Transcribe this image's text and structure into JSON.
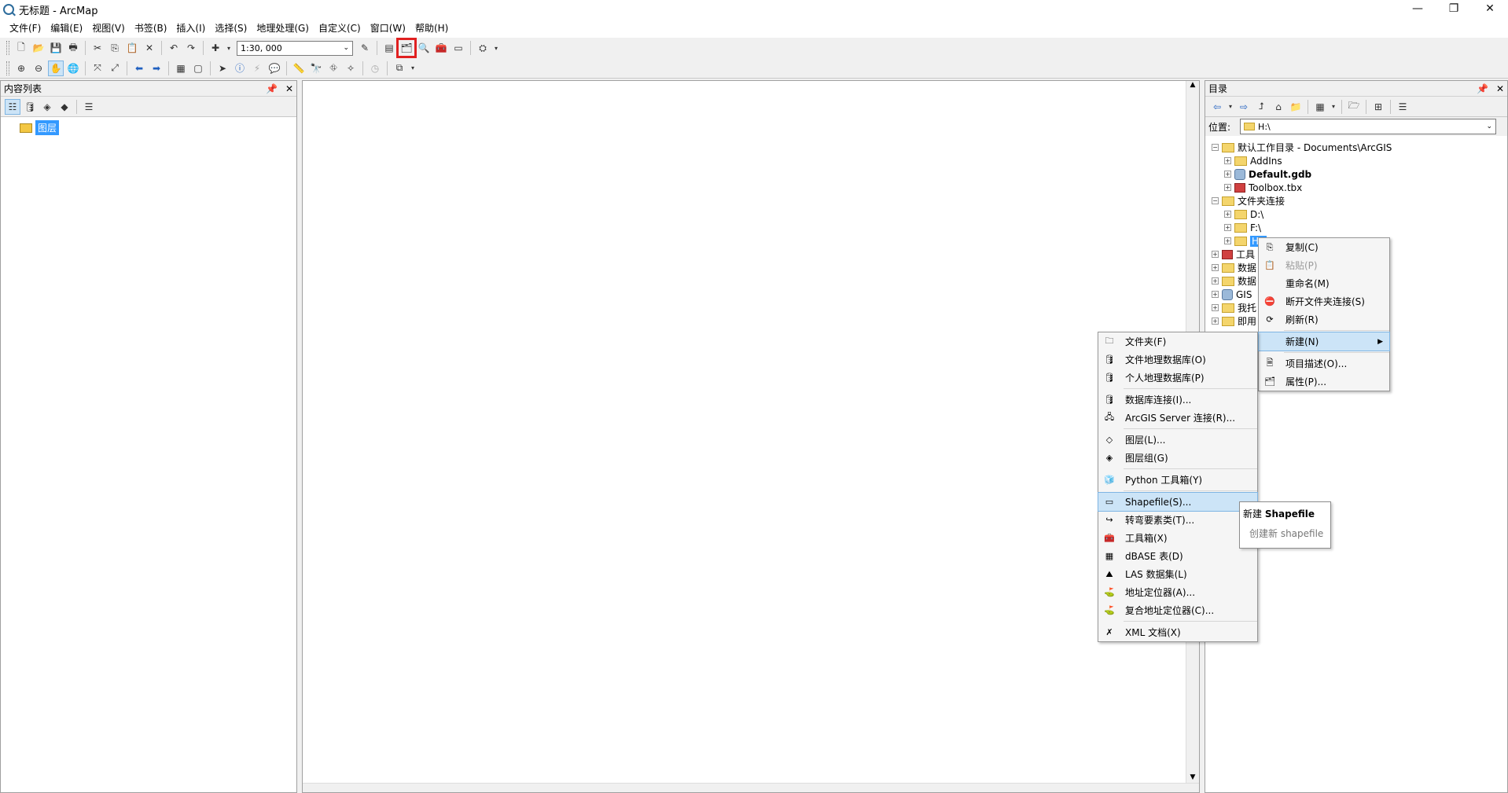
{
  "window": {
    "title": "无标题 - ArcMap"
  },
  "menubar": [
    "文件(F)",
    "编辑(E)",
    "视图(V)",
    "书签(B)",
    "插入(I)",
    "选择(S)",
    "地理处理(G)",
    "自定义(C)",
    "窗口(W)",
    "帮助(H)"
  ],
  "toolbar": {
    "scale_value": "1:30, 000"
  },
  "toc": {
    "title": "内容列表",
    "layer_label": "图层"
  },
  "catalog": {
    "title": "目录",
    "location_label": "位置:",
    "location_value": "H:\\",
    "tree": [
      {
        "label": "默认工作目录 - Documents\\ArcGIS",
        "level": 0,
        "icon": "folder-home-icon",
        "exp": "−"
      },
      {
        "label": "AddIns",
        "level": 1,
        "icon": "folder-icon",
        "exp": "+"
      },
      {
        "label": "Default.gdb",
        "level": 1,
        "icon": "geodatabase-icon",
        "exp": "+",
        "bold": true
      },
      {
        "label": "Toolbox.tbx",
        "level": 1,
        "icon": "toolbox-icon",
        "exp": "+"
      },
      {
        "label": "文件夹连接",
        "level": 0,
        "icon": "folder-icon",
        "exp": "−"
      },
      {
        "label": "D:\\",
        "level": 1,
        "icon": "folder-icon",
        "exp": "+"
      },
      {
        "label": "F:\\",
        "level": 1,
        "icon": "folder-icon",
        "exp": "+"
      },
      {
        "label": "H:\\",
        "level": 1,
        "icon": "folder-icon",
        "exp": "+",
        "selected": true
      },
      {
        "label": "工具",
        "level": 0,
        "icon": "toolbox-icon",
        "exp": "+"
      },
      {
        "label": "数据",
        "level": 0,
        "icon": "folder-icon",
        "exp": "+"
      },
      {
        "label": "数据",
        "level": 0,
        "icon": "folder-icon",
        "exp": "+"
      },
      {
        "label": "GIS",
        "level": 0,
        "icon": "gis-server-icon",
        "exp": "+"
      },
      {
        "label": "我托",
        "level": 0,
        "icon": "folder-icon",
        "exp": "+"
      },
      {
        "label": "即用",
        "level": 0,
        "icon": "folder-icon",
        "exp": "+"
      }
    ]
  },
  "context_menu": [
    {
      "label": "复制(C)",
      "icon": "copy-icon"
    },
    {
      "label": "粘贴(P)",
      "icon": "paste-icon",
      "disabled": true
    },
    {
      "label": "重命名(M)",
      "icon": ""
    },
    {
      "label": "断开文件夹连接(S)",
      "icon": "disconnect-icon"
    },
    {
      "label": "刷新(R)",
      "icon": "refresh-icon",
      "sep_after": true
    },
    {
      "label": "新建(N)",
      "icon": "",
      "active": true,
      "submenu": true,
      "sep_after": true
    },
    {
      "label": "项目描述(O)...",
      "icon": "description-icon"
    },
    {
      "label": "属性(P)...",
      "icon": "properties-icon"
    }
  ],
  "new_menu": [
    {
      "label": "文件夹(F)",
      "icon": "folder-icon"
    },
    {
      "label": "文件地理数据库(O)",
      "icon": "file-gdb-icon"
    },
    {
      "label": "个人地理数据库(P)",
      "icon": "personal-gdb-icon",
      "sep_after": true
    },
    {
      "label": "数据库连接(I)...",
      "icon": "db-connection-icon"
    },
    {
      "label": "ArcGIS Server 连接(R)...",
      "icon": "server-connection-icon",
      "sep_after": true
    },
    {
      "label": "图层(L)...",
      "icon": "layer-icon"
    },
    {
      "label": "图层组(G)",
      "icon": "group-layer-icon",
      "sep_after": true
    },
    {
      "label": "Python 工具箱(Y)",
      "icon": "python-toolbox-icon",
      "sep_after": true
    },
    {
      "label": "Shapefile(S)...",
      "icon": "shapefile-icon",
      "active": true
    },
    {
      "label": "转弯要素类(T)...",
      "icon": "turn-feature-class-icon"
    },
    {
      "label": "工具箱(X)",
      "icon": "toolbox-icon"
    },
    {
      "label": "dBASE 表(D)",
      "icon": "dbase-table-icon"
    },
    {
      "label": "LAS 数据集(L)",
      "icon": "las-dataset-icon"
    },
    {
      "label": "地址定位器(A)...",
      "icon": "address-locator-icon"
    },
    {
      "label": "复合地址定位器(C)...",
      "icon": "composite-locator-icon",
      "sep_after": true
    },
    {
      "label": "XML 文档(X)",
      "icon": "xml-document-icon"
    }
  ],
  "tooltip": {
    "title_prefix": "新建 ",
    "title_bold": "Shapefile",
    "description": "创建新 shapefile"
  },
  "colors": {
    "selection": "#3399ff",
    "highlight_box": "#e02020",
    "menu_active": "#cce4f7"
  }
}
